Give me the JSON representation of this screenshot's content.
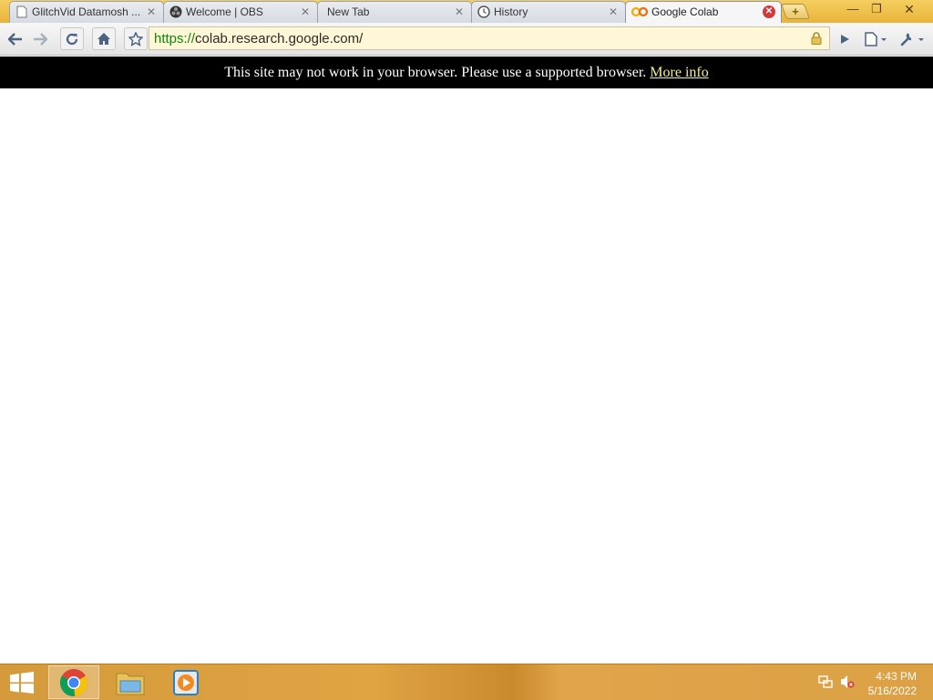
{
  "tabs": [
    {
      "label": "GlitchVid Datamosh ...",
      "icon": "page-icon"
    },
    {
      "label": "Welcome | OBS",
      "icon": "obs-icon"
    },
    {
      "label": "New Tab",
      "icon": "none"
    },
    {
      "label": "History",
      "icon": "history-icon"
    },
    {
      "label": "Google Colab",
      "icon": "colab-icon",
      "active": true
    }
  ],
  "omnibox": {
    "scheme": "https://",
    "host": "colab.research.google.com/"
  },
  "infobar": {
    "message": "This site may not work in your browser. Please use a supported browser.",
    "link": "More info"
  },
  "clock": {
    "time": "4:43 PM",
    "date": "5/16/2022"
  },
  "colors": {
    "infobar_bg": "#000000",
    "link": "#f3f08a",
    "url_scheme": "#0a8a0a",
    "taskbar": "#dba144"
  }
}
